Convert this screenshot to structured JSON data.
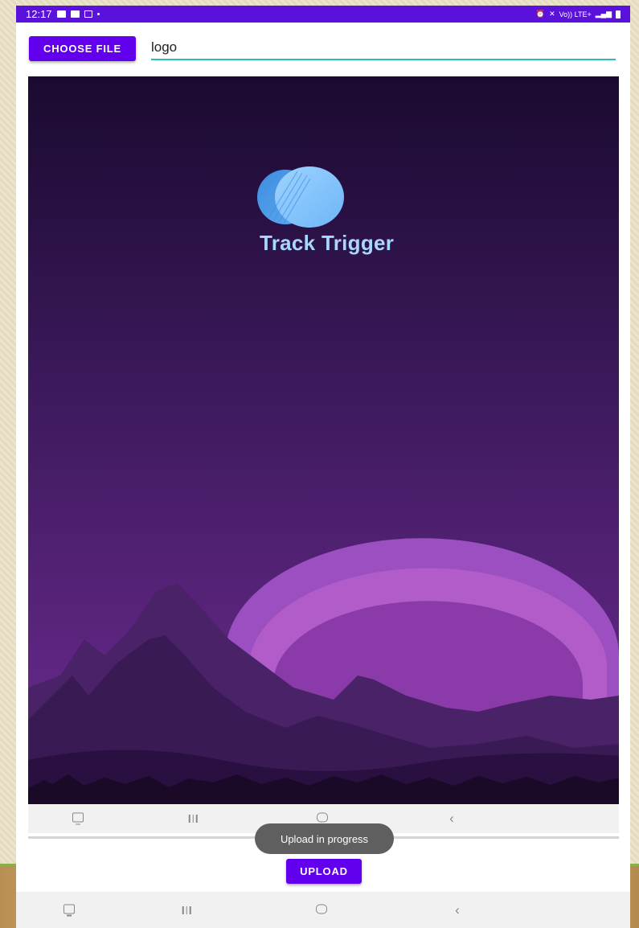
{
  "status_bar": {
    "time": "12:17",
    "left_icons": [
      "gallery-icon",
      "screen-cast-icon",
      "video-icon",
      "dot-icon"
    ],
    "right_icons": [
      "alarm-icon",
      "mute-icon",
      "volte-lte-icon",
      "signal-icon",
      "battery-icon"
    ],
    "network_label": "Vo)) LTE+"
  },
  "toolbar": {
    "choose_file_label": "CHOOSE FILE",
    "file_name_value": "logo"
  },
  "preview": {
    "brand_name": "Track Trigger",
    "brand_color": "#a9d6ff",
    "sky_top": "#1a0a30",
    "sky_bottom": "#6b2a8a",
    "sun_color": "#b25cc9"
  },
  "inner_nav": {
    "icons": [
      "screenshot-icon",
      "recents-icon",
      "home-icon",
      "back-icon"
    ]
  },
  "toast": {
    "message": "Upload in progress"
  },
  "upload": {
    "label": "UPLOAD"
  },
  "bottom_nav": {
    "icons": [
      "screenshot-icon",
      "recents-icon",
      "home-icon",
      "back-icon"
    ]
  },
  "colors": {
    "status_bar": "#5b11dc",
    "primary": "#6200ee",
    "input_underline": "#26bfb7",
    "toast_bg": "#5f5f5f"
  }
}
